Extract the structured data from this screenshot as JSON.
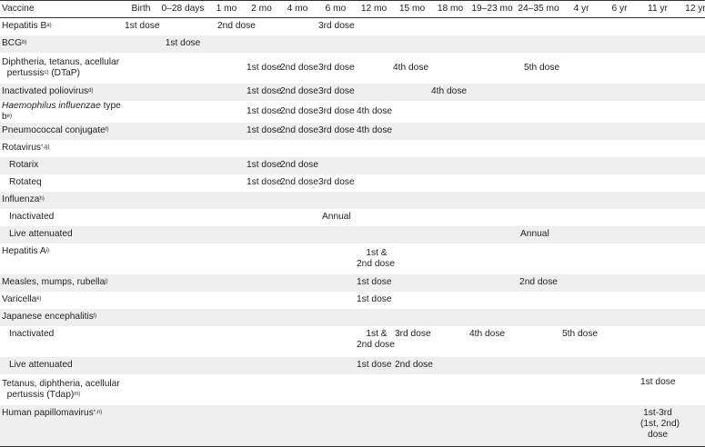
{
  "header": {
    "vaccine": "Vaccine",
    "ages": [
      "Birth",
      "0–28 days",
      "1 mo",
      "2 mo",
      "4 mo",
      "6 mo",
      "12 mo",
      "15 mo",
      "18 mo",
      "19–23 mo",
      "24–35 mo",
      "4 yr",
      "6 yr",
      "11 yr",
      "12 yr"
    ]
  },
  "rows": {
    "hepb": {
      "name": "Hepatitis B",
      "sup": "a)",
      "d1": "1st dose",
      "d2": "2nd dose",
      "d3": "3rd dose"
    },
    "bcg": {
      "name": "BCG",
      "sup": "b)",
      "d1": "1st dose"
    },
    "dtap": {
      "name1": "Diphtheria, tetanus, acellular",
      "name2": "pertussis",
      "sup": "c)",
      "name3": " (DTaP)",
      "d1": "1st dose",
      "d2": "2nd dose",
      "d3": "3rd dose",
      "d4": "4th dose",
      "d5": "5th dose"
    },
    "ipv": {
      "name": "Inactivated poliovirus",
      "sup": "d)",
      "d1": "1st dose",
      "d2": "2nd dose",
      "d3": "3rd dose",
      "d4": "4th dose"
    },
    "hib": {
      "name_it": "Haemophilus influenzae",
      "name": " type b",
      "sup": "e)",
      "d1": "1st dose",
      "d2": "2nd dose",
      "d3": "3rd dose",
      "d4": "4th dose"
    },
    "pcv": {
      "name": "Pneumococcal conjugate",
      "sup": "f)",
      "d1": "1st dose",
      "d2": "2nd dose",
      "d3": "3rd dose",
      "d4": "4th dose"
    },
    "rota": {
      "name": "Rotavirus",
      "sup": "*,g)"
    },
    "rotarix": {
      "name": "Rotarix",
      "d1": "1st dose",
      "d2": "2nd dose"
    },
    "rotateq": {
      "name": "Rotateq",
      "d1": "1st dose",
      "d2": "2nd dose",
      "d3": "3rd dose"
    },
    "flu": {
      "name": "Influenza",
      "sup": "h)"
    },
    "flu_inact": {
      "name": "Inactivated",
      "d": "Annual"
    },
    "flu_live": {
      "name": "Live attenuated",
      "d": "Annual"
    },
    "hepa": {
      "name": "Hepatitis A",
      "sup": "i)",
      "d1a": "1st &",
      "d1b": "2nd dose"
    },
    "mmr": {
      "name": "Measles, mumps, rubella",
      "sup": "j)",
      "d1": "1st dose",
      "d2": "2nd dose"
    },
    "var": {
      "name": "Varicella",
      "sup": "k)",
      "d1": "1st dose"
    },
    "je": {
      "name": "Japanese encephalitis",
      "sup": "l)"
    },
    "je_inact": {
      "name": "Inactivated",
      "d1a": "1st &",
      "d1b": "2nd dose",
      "d3": "3rd dose",
      "d4": "4th dose",
      "d5": "5th dose"
    },
    "je_live": {
      "name": "Live attenuated",
      "d1": "1st dose",
      "d2": "2nd dose"
    },
    "tdap": {
      "name1": "Tetanus, diphtheria, acellular",
      "name2": "pertussis (Tdap)",
      "sup": "m)",
      "d1": "1st dose"
    },
    "hpv": {
      "name": "Human papillomavirus",
      "sup": "*,n)",
      "d1a": "1st-3rd",
      "d1b": "(1st, 2nd)",
      "d1c": "dose"
    }
  }
}
